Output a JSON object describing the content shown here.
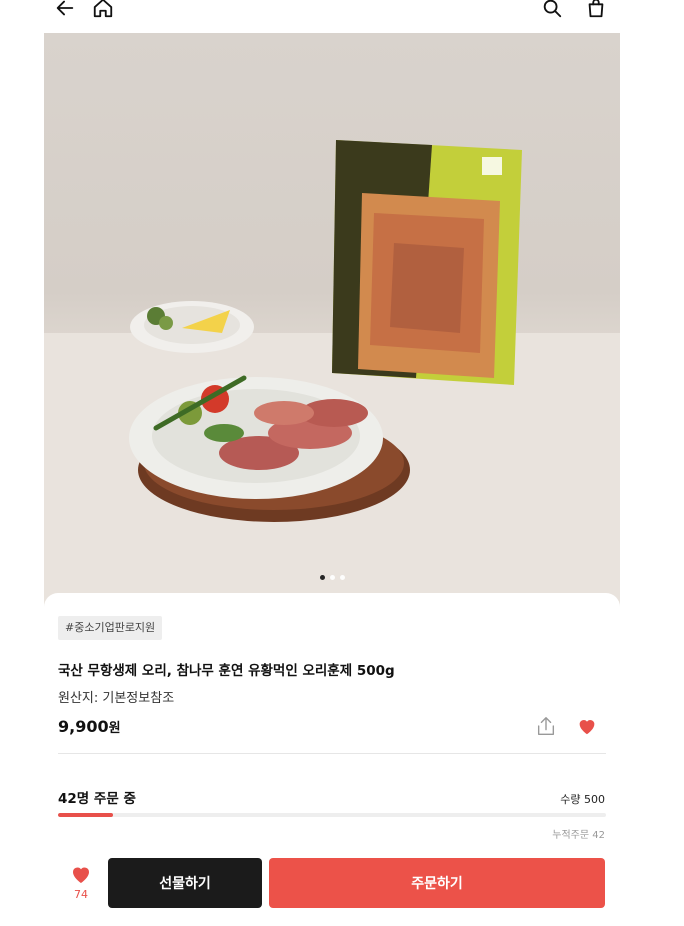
{
  "nav": {
    "back_icon": "arrow-left-icon",
    "home_icon": "home-icon",
    "search_icon": "search-icon",
    "cart_icon": "shopping-bag-icon"
  },
  "gallery": {
    "slide_count": 3,
    "active_slide": 1
  },
  "product": {
    "tag": "#중소기업판로지원",
    "title": "국산 무항생제 오리, 참나무 훈연 유황먹인 오리훈제 500g",
    "origin": "원산지: 기본정보참조",
    "price": "9,900",
    "price_unit": "원",
    "share_icon": "share-icon",
    "like_icon": "heart-icon"
  },
  "orders": {
    "status": "42명 주문 중",
    "quantity": "수량 500",
    "progress_fraction": 0.1,
    "cumulative": "누적주문 42"
  },
  "bottom_bar": {
    "wish_icon": "heart-icon",
    "wish_count": "74",
    "gift_label": "선물하기",
    "order_label": "주문하기"
  },
  "colors": {
    "accent": "#e8504a",
    "order_button": "#ec5249",
    "gift_button": "#1b1b1b"
  }
}
